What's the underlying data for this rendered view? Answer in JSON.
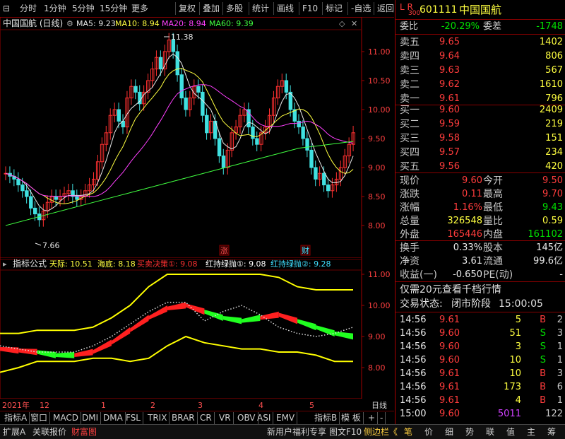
{
  "toolbar": {
    "left_items": [
      "分时",
      "1分钟",
      "5分钟",
      "15分钟",
      "更多"
    ],
    "right_items": [
      "复权",
      "叠加",
      "多股",
      "统计",
      "画线",
      "F10",
      "标记",
      "-自选",
      "返回"
    ]
  },
  "main_chart": {
    "title": "中国国航 (日线)",
    "ma_labels": [
      {
        "text": "MA5: 9.23",
        "color": "#e8e8e8"
      },
      {
        "text": "MA10: 8.94",
        "color": "#ffff40"
      },
      {
        "text": "MA20: 8.94",
        "color": "#ff40ff"
      },
      {
        "text": "MA60: 9.39",
        "color": "#40ff40"
      }
    ],
    "high_label": "11.38",
    "low_label": "7.66",
    "y_ticks": [
      "11.00",
      "10.50",
      "10.00",
      "9.50",
      "9.00",
      "8.50",
      "8.00"
    ],
    "markers": [
      {
        "text": "涨",
        "color": "#ff5050"
      },
      {
        "text": "财",
        "color": "#40e0ff"
      }
    ]
  },
  "indicator_chart": {
    "title": "指标公式",
    "labels": [
      {
        "text": "天际: 10.51",
        "color": "#ffff40"
      },
      {
        "text": "海底: 8.18",
        "color": "#ffff40"
      },
      {
        "text": "买卖决策①: 9.08",
        "color": "#ff3030"
      },
      {
        "text": "红持绿抛①: 9.08",
        "color": "#ffffff"
      },
      {
        "text": "红持绿抛②: 9.28",
        "color": "#40e0ff"
      }
    ],
    "y_ticks": [
      "11.00",
      "10.00",
      "9.00",
      "8.00"
    ]
  },
  "date_axis": {
    "year": "2021年",
    "months": [
      "12",
      "1",
      "2",
      "3",
      "4",
      "5"
    ],
    "right_label": "日线"
  },
  "indicator_tabs": [
    "指标A",
    "窗口",
    "MACD",
    "DMI",
    "DMA",
    "FSL",
    "TRIX",
    "BRAR",
    "CR",
    "VR",
    "OBV",
    "ASI",
    "EMV",
    "指标B",
    "模 板",
    "+",
    "-"
  ],
  "bottom_tabs": {
    "left": [
      "扩展A",
      "关联报价",
      "财富图"
    ],
    "mid": [
      "新用户福利专享",
      "图文F10",
      "侧边栏《"
    ],
    "right": [
      "笔",
      "价",
      "细",
      "势",
      "联",
      "值",
      "主",
      "筹"
    ]
  },
  "quote": {
    "header": {
      "flags_top": "L R",
      "flags_sub": "300",
      "code": "601111",
      "name": "中国国航"
    },
    "weibi": {
      "label": "委比",
      "value": "-20.29%",
      "label2": "委差",
      "value2": "-1748"
    },
    "sell": [
      {
        "label": "卖五",
        "price": "9.65",
        "vol": "1402"
      },
      {
        "label": "卖四",
        "price": "9.64",
        "vol": "806"
      },
      {
        "label": "卖三",
        "price": "9.63",
        "vol": "567"
      },
      {
        "label": "卖二",
        "price": "9.62",
        "vol": "1610"
      },
      {
        "label": "卖一",
        "price": "9.61",
        "vol": "796"
      }
    ],
    "buy": [
      {
        "label": "买一",
        "price": "9.60",
        "vol": "2409"
      },
      {
        "label": "买二",
        "price": "9.59",
        "vol": "219"
      },
      {
        "label": "买三",
        "price": "9.58",
        "vol": "151"
      },
      {
        "label": "买四",
        "price": "9.57",
        "vol": "234"
      },
      {
        "label": "买五",
        "price": "9.56",
        "vol": "420"
      }
    ],
    "stats": [
      {
        "l1": "现价",
        "v1": "9.60",
        "c1": "red",
        "l2": "今开",
        "v2": "9.50",
        "c2": "red"
      },
      {
        "l1": "涨跌",
        "v1": "0.11",
        "c1": "red",
        "l2": "最高",
        "v2": "9.70",
        "c2": "red"
      },
      {
        "l1": "涨幅",
        "v1": "1.16%",
        "c1": "red",
        "l2": "最低",
        "v2": "9.43",
        "c2": "green"
      },
      {
        "l1": "总量",
        "v1": "326548",
        "c1": "yellow",
        "l2": "量比",
        "v2": "0.59",
        "c2": "yellow"
      },
      {
        "l1": "外盘",
        "v1": "165446",
        "c1": "red",
        "l2": "内盘",
        "v2": "161102",
        "c2": "green"
      }
    ],
    "stats2": [
      {
        "l1": "换手",
        "v1": "0.33%",
        "l2": "股本",
        "v2": "145亿"
      },
      {
        "l1": "净资",
        "v1": "3.61",
        "l2": "流通",
        "v2": "99.6亿"
      },
      {
        "l1": "收益(一)",
        "v1": "-0.650",
        "l2": "PE(动)",
        "v2": "-"
      }
    ],
    "promo": "仅需20元查看千档行情",
    "status_label": "交易状态:",
    "status_value": "闭市阶段",
    "status_time": "15:00:05",
    "trades": [
      {
        "time": "14:56",
        "price": "9.61",
        "vol": "5",
        "bs": "B",
        "n": "2"
      },
      {
        "time": "14:56",
        "price": "9.60",
        "vol": "51",
        "bs": "S",
        "n": "3"
      },
      {
        "time": "14:56",
        "price": "9.60",
        "vol": "3",
        "bs": "S",
        "n": "1"
      },
      {
        "time": "14:56",
        "price": "9.60",
        "vol": "10",
        "bs": "S",
        "n": "1"
      },
      {
        "time": "14:56",
        "price": "9.61",
        "vol": "10",
        "bs": "B",
        "n": "3"
      },
      {
        "time": "14:56",
        "price": "9.61",
        "vol": "173",
        "bs": "B",
        "n": "6"
      },
      {
        "time": "14:56",
        "price": "9.61",
        "vol": "4",
        "bs": "B",
        "n": "1"
      },
      {
        "time": "15:00",
        "price": "9.60",
        "vol": "5011",
        "bs": "",
        "n": "122"
      }
    ]
  }
}
